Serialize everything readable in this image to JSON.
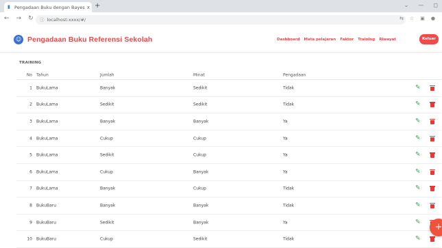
{
  "browser": {
    "tab_title": "Pengadaan Buku dengan Bayes",
    "tab_close": "x",
    "new_tab": "+",
    "url": "localhost:xxxx/#/"
  },
  "header": {
    "brand": "Pengadaan Buku Referensi Sekolah",
    "menu": [
      "Dashboard",
      "Mata pelajaran",
      "Faktor",
      "Training",
      "Riwayat"
    ],
    "logout_label": "Keluar"
  },
  "section_title": "TRAINING",
  "table": {
    "columns": [
      "No",
      "Tahun",
      "Jumlah",
      "Minat",
      "Pengadaan"
    ],
    "rows": [
      {
        "no": "1",
        "tahun": "BukuLama",
        "jumlah": "Banyak",
        "minat": "Sedikit",
        "pengadaan": "Tidak"
      },
      {
        "no": "2",
        "tahun": "BukuLama",
        "jumlah": "Sedikit",
        "minat": "Sedikit",
        "pengadaan": "Tidak"
      },
      {
        "no": "3",
        "tahun": "BukuLama",
        "jumlah": "Banyak",
        "minat": "Banyak",
        "pengadaan": "Ya"
      },
      {
        "no": "4",
        "tahun": "BukuLama",
        "jumlah": "Cukup",
        "minat": "Cukup",
        "pengadaan": "Ya"
      },
      {
        "no": "5",
        "tahun": "BukuLama",
        "jumlah": "Sedikit",
        "minat": "Cukup",
        "pengadaan": "Ya"
      },
      {
        "no": "6",
        "tahun": "BukuLama",
        "jumlah": "Cukup",
        "minat": "Banyak",
        "pengadaan": "Ya"
      },
      {
        "no": "7",
        "tahun": "BukuLama",
        "jumlah": "Banyak",
        "minat": "Cukup",
        "pengadaan": "Tidak"
      },
      {
        "no": "8",
        "tahun": "BukuBaru",
        "jumlah": "Banyak",
        "minat": "Banyak",
        "pengadaan": "Tidak"
      },
      {
        "no": "9",
        "tahun": "BukuBaru",
        "jumlah": "Sedikit",
        "minat": "Banyak",
        "pengadaan": "Ya"
      },
      {
        "no": "10",
        "tahun": "BukuBaru",
        "jumlah": "Cukup",
        "minat": "Sedikit",
        "pengadaan": "Tidak"
      }
    ]
  },
  "fab_label": "+",
  "colors": {
    "brand": "#e5494a",
    "logout_bg": "#ef4b4b",
    "edit_icon": "#2e9e4d",
    "delete_icon": "#e53935",
    "fab": "#f0523c"
  }
}
